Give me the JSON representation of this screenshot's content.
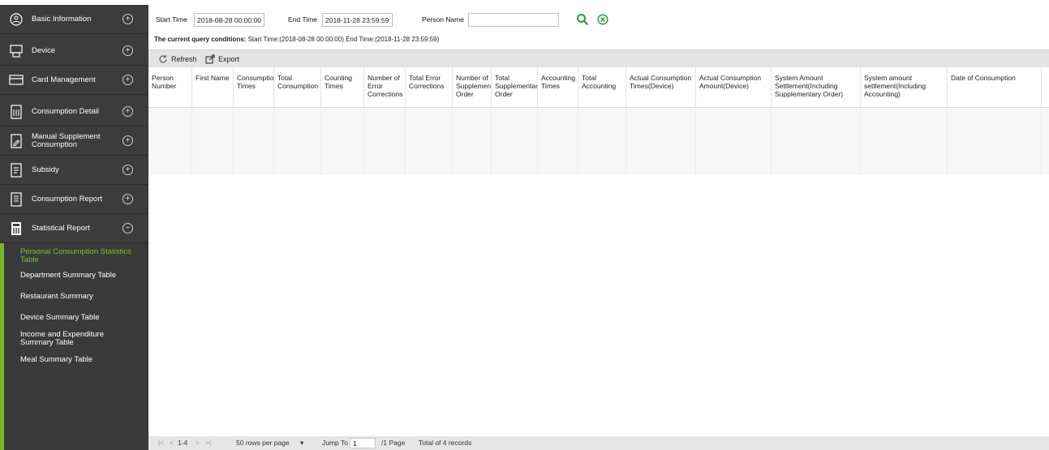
{
  "sidebar": {
    "items": [
      {
        "label": "Basic Information",
        "icon": "globe-icon",
        "toggle": "⊕"
      },
      {
        "label": "Device",
        "icon": "device-icon",
        "toggle": "⊕"
      },
      {
        "label": "Card Management",
        "icon": "card-icon",
        "toggle": "⊕"
      },
      {
        "label": "Consumption Detail",
        "icon": "detail-icon",
        "toggle": "⊕"
      },
      {
        "label": "Manual Supplement Consumption",
        "icon": "edit-document-icon",
        "toggle": "⊕"
      },
      {
        "label": "Subsidy",
        "icon": "subsidy-icon",
        "toggle": "⊕"
      },
      {
        "label": "Consumption Report",
        "icon": "report-icon",
        "toggle": "⊕"
      },
      {
        "label": "Statistical Report",
        "icon": "statistics-icon",
        "toggle": "⊖"
      }
    ],
    "submenu": [
      "Personal Consumption Statistics Table",
      "Department Summary Table",
      "Restaurant Summary",
      "Device Summary Table",
      "Income and Expenditure Summary Table",
      "Meal Summary Table"
    ]
  },
  "query": {
    "start_label": "Start Time",
    "start_value": "2018-08-28 00:00:00",
    "end_label": "End Time",
    "end_value": "2018-11-28 23:59:59",
    "person_label": "Person Name",
    "person_value": ""
  },
  "conditions": {
    "prefix": "The current query conditions:",
    "text": "Start Time:(2018-08-28 00:00:00)  End Time:(2018-11-28 23:59:59)"
  },
  "toolbar": {
    "refresh": "Refresh",
    "export": "Export"
  },
  "table": {
    "columns": [
      "Person Number",
      "First Name",
      "Consumption Times",
      "Total Consumption",
      "Counting Times",
      "Number of Error Corrections",
      "Total Error Corrections",
      "Number of Supplementary Order",
      "Total Supplementary Order",
      "Accounting Times",
      "Total Accounting",
      "Actual Consumption Times(Device)",
      "Actual Consumption Amount(Device)",
      "System Amount Settlement(Including Supplementary Order)",
      "System amount settlement(Including Accounting)",
      "Date of Consumption"
    ],
    "rows": []
  },
  "pager": {
    "first": "|<",
    "prev": "<",
    "range": "1-4",
    "next": ">",
    "last": ">|",
    "per_page": "50 rows per page",
    "dropdown": "▾",
    "jump_label": "Jump To",
    "page_value": "1",
    "page_total": "/1 Page",
    "total": "Total of 4 records"
  },
  "colors": {
    "sidebar_bg": "#3c3c3c",
    "accent_green": "#76b82a",
    "search_icon": "#2e9b3a",
    "toolbar_bg": "#e3e3e3"
  }
}
